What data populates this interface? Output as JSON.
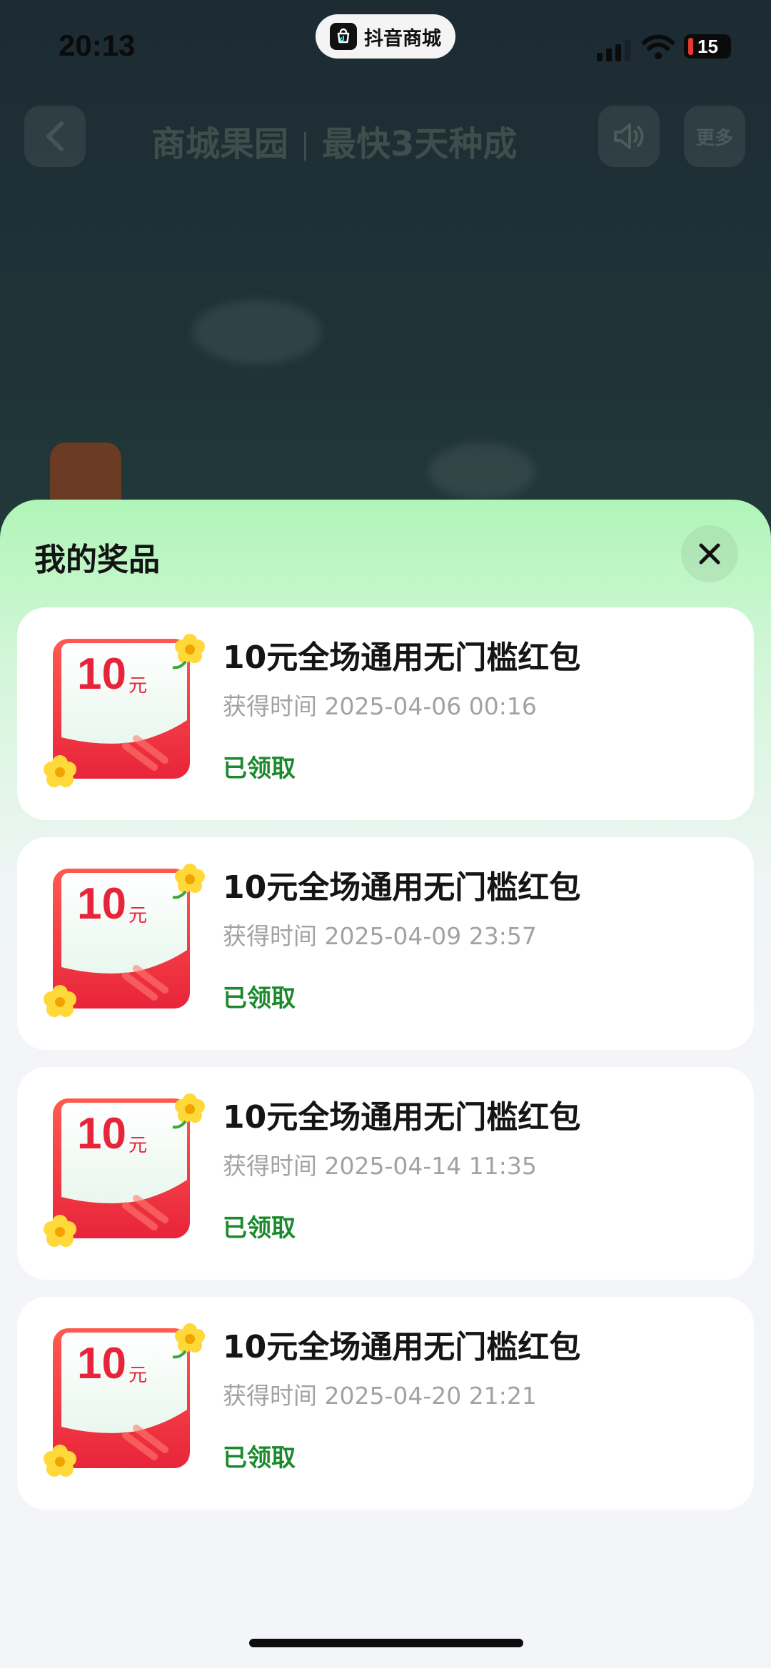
{
  "status_bar": {
    "time": "20:13",
    "app_name": "抖音商城",
    "battery": "15"
  },
  "header": {
    "title": "商城果园",
    "subtitle": "最快3天种成",
    "more_label": "更多"
  },
  "sheet": {
    "title": "我的奖品",
    "prizes": [
      {
        "amount": "10",
        "unit": "元",
        "name": "10元全场通用无门槛红包",
        "time": "获得时间 2025-04-06 00:16",
        "status": "已领取"
      },
      {
        "amount": "10",
        "unit": "元",
        "name": "10元全场通用无门槛红包",
        "time": "获得时间 2025-04-09 23:57",
        "status": "已领取"
      },
      {
        "amount": "10",
        "unit": "元",
        "name": "10元全场通用无门槛红包",
        "time": "获得时间 2025-04-14 11:35",
        "status": "已领取"
      },
      {
        "amount": "10",
        "unit": "元",
        "name": "10元全场通用无门槛红包",
        "time": "获得时间 2025-04-20 21:21",
        "status": "已领取"
      }
    ]
  },
  "colors": {
    "status_claimed": "#1b8a2d",
    "coupon_red": "#f03a3f",
    "sheet_top": "#b0f5b7"
  },
  "icons": [
    "back-arrow-icon",
    "speaker-icon",
    "close-icon",
    "flower-icon",
    "signal-icon",
    "wifi-icon",
    "battery-icon"
  ]
}
